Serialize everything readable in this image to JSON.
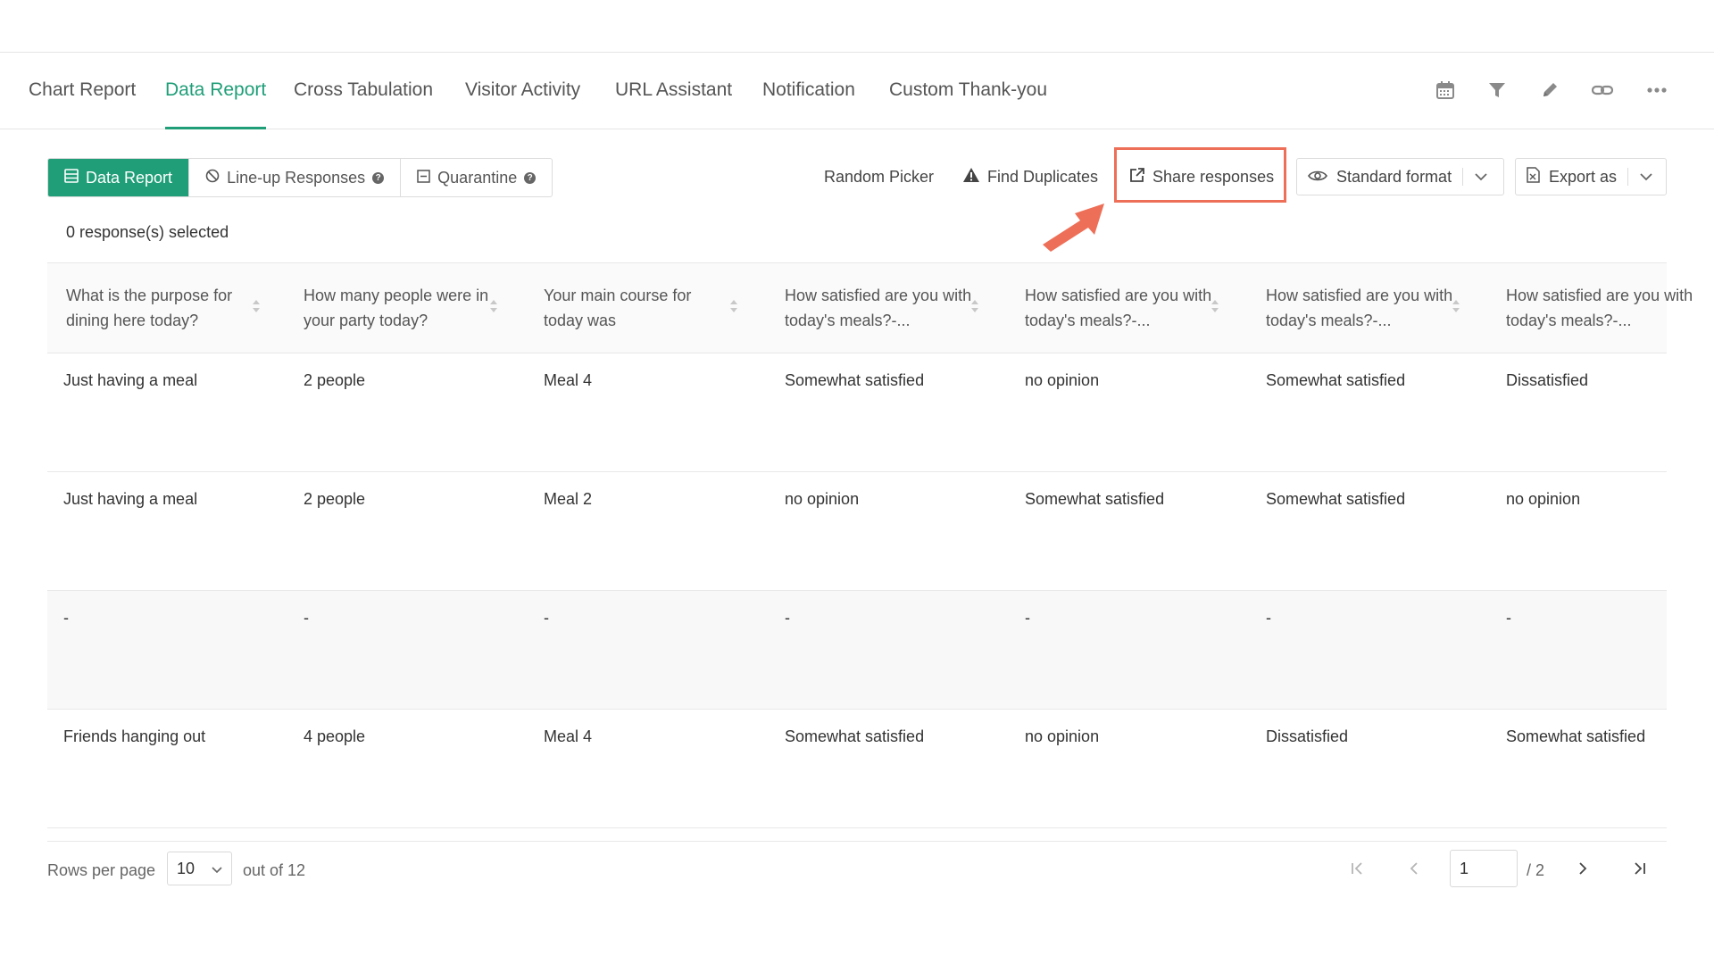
{
  "tabs": [
    {
      "label": "Chart Report",
      "active": false
    },
    {
      "label": "Data Report",
      "active": true
    },
    {
      "label": "Cross Tabulation",
      "active": false
    },
    {
      "label": "Visitor Activity",
      "active": false
    },
    {
      "label": "URL Assistant",
      "active": false
    },
    {
      "label": "Notification",
      "active": false
    },
    {
      "label": "Custom Thank-you",
      "active": false
    }
  ],
  "tab_icons": [
    "calendar-icon",
    "filter-icon",
    "pencil-icon",
    "link-icon",
    "more-icon"
  ],
  "view_toggle": {
    "data_report": "Data Report",
    "lineup_responses": "Line-up Responses",
    "quarantine": "Quarantine"
  },
  "toolbar": {
    "random_picker": "Random Picker",
    "find_duplicates": "Find Duplicates",
    "share_responses": "Share responses",
    "standard_format": "Standard format",
    "export_as": "Export as"
  },
  "selection": {
    "text": "0 response(s) selected"
  },
  "table": {
    "columns": [
      "What is the purpose for dining here today?",
      "How many people were in your party today?",
      "Your main course for today was",
      "How satisfied are you with today's meals?-...",
      "How satisfied are you with today's meals?-...",
      "How satisfied are you with today's meals?-...",
      "How satisfied are you with today's meals?-..."
    ],
    "rows": [
      [
        "Just having a meal",
        "2 people",
        "Meal 4",
        "Somewhat satisfied",
        "no opinion",
        "Somewhat satisfied",
        "Dissatisfied"
      ],
      [
        "Just having a meal",
        "2 people",
        "Meal 2",
        "no opinion",
        "Somewhat satisfied",
        "Somewhat satisfied",
        "no opinion"
      ],
      [
        "-",
        "-",
        "-",
        "-",
        "-",
        "-",
        "-"
      ],
      [
        "Friends hanging out",
        "4 people",
        "Meal 4",
        "Somewhat satisfied",
        "no opinion",
        "Dissatisfied",
        "Somewhat satisfied"
      ]
    ]
  },
  "pagination": {
    "rows_per_page_label": "Rows per page",
    "rows_per_page_value": "10",
    "out_of": "out of 12",
    "current_page": "1",
    "total_pages": "/ 2"
  },
  "colors": {
    "accent": "#1f9e77",
    "highlight": "#ee6f57"
  }
}
